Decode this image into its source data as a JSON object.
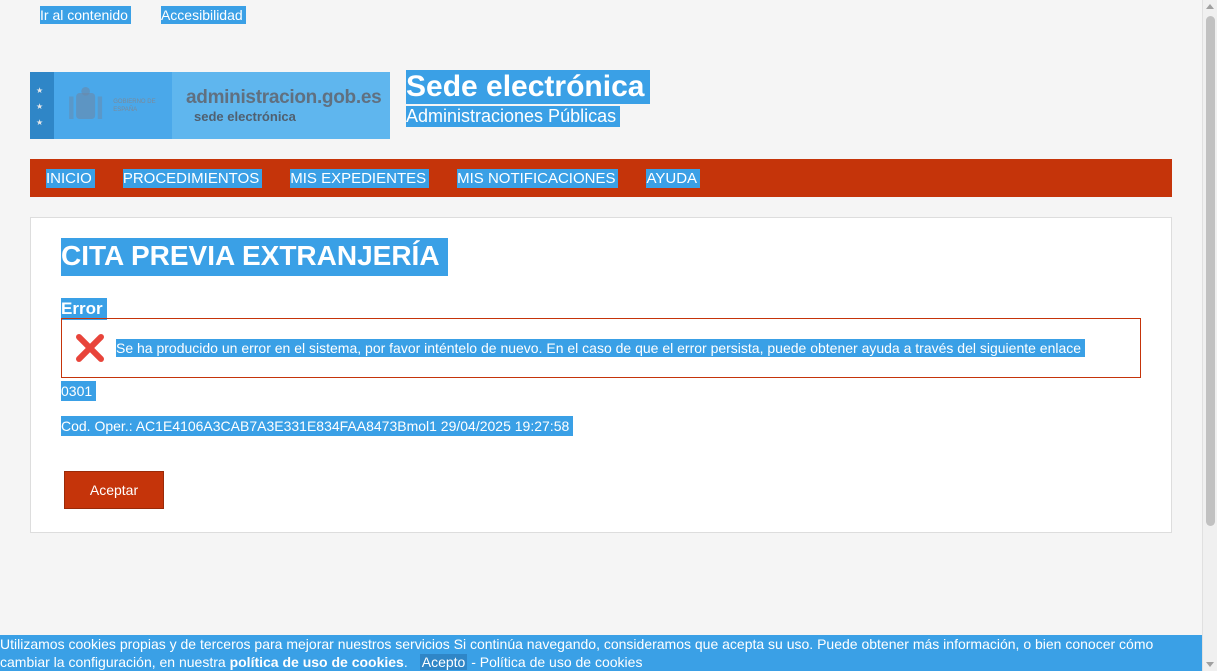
{
  "skip_links": {
    "content": "Ir al contenido",
    "accessibility": "Accesibilidad"
  },
  "header": {
    "logo_gov_text": "GOBIERNO DE ESPAÑA",
    "logo_admin_text": "administracion.gob.es",
    "logo_admin_sub": "sede electrónica",
    "title": "Sede electrónica",
    "subtitle": "Administraciones Públicas"
  },
  "nav": {
    "items": [
      {
        "label": "INICIO"
      },
      {
        "label": "PROCEDIMIENTOS"
      },
      {
        "label": "MIS EXPEDIENTES"
      },
      {
        "label": "MIS NOTIFICACIONES"
      },
      {
        "label": "AYUDA"
      }
    ]
  },
  "main": {
    "title": "CITA PREVIA EXTRANJERÍA",
    "error_label": "Error",
    "error_message": "Se ha producido un error en el sistema, por favor inténtelo de nuevo. En el caso de que el error persista, puede obtener ayuda a través del siguiente enlace",
    "error_code": "0301",
    "oper_code": "Cod. Oper.: AC1E4106A3CAB7A3E331E834FAA8473Bmol1 29/04/2025 19:27:58",
    "accept_button": "Aceptar"
  },
  "cookie_banner": {
    "text_part1": "Utilizamos cookies propias y de terceros para mejorar nuestros servicios Si continúa navegando, consideramos que acepta su uso. Puede obtener más información, o bien conocer cómo cambiar la configuración, en nuestra",
    "policy_bold": "política de uso de cookies",
    "period": ".",
    "accept_link": "Acepto",
    "separator": " - ",
    "policy_link": "Política de uso de cookies"
  },
  "colors": {
    "accent_red": "#c5340a",
    "selection_blue": "#3aa0e6"
  }
}
